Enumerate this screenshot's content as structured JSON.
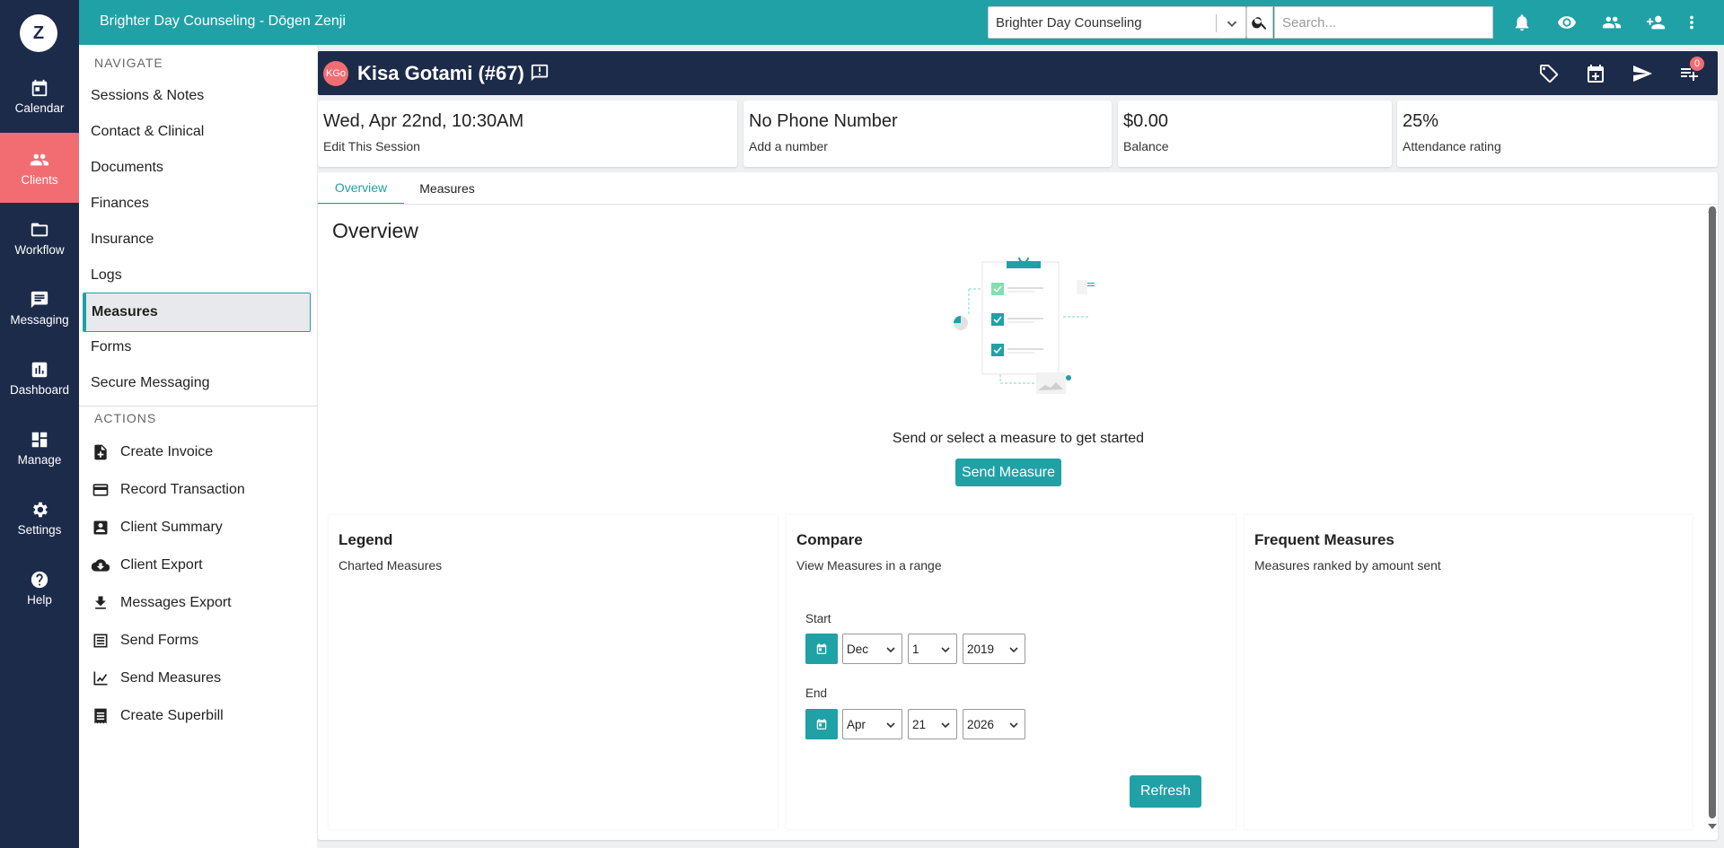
{
  "app": {
    "logo_letter": "Z",
    "title": "Brighter Day Counseling - Dōgen Zenji"
  },
  "rail": {
    "items": [
      {
        "label": "Calendar",
        "icon": "calendar-icon"
      },
      {
        "label": "Clients",
        "icon": "clients-icon",
        "active": true
      },
      {
        "label": "Workflow",
        "icon": "folder-icon"
      },
      {
        "label": "Messaging",
        "icon": "message-icon"
      },
      {
        "label": "Dashboard",
        "icon": "chart-icon"
      },
      {
        "label": "Manage",
        "icon": "grid-icon"
      },
      {
        "label": "Settings",
        "icon": "gear-icon"
      },
      {
        "label": "Help",
        "icon": "help-icon"
      }
    ]
  },
  "topbar": {
    "org_select_value": "Brighter Day Counseling",
    "search_placeholder": "Search...",
    "icons": [
      "bell-icon",
      "eye-icon",
      "people-icon",
      "add-person-icon",
      "more-vertical-icon"
    ]
  },
  "sidenav": {
    "navigate_header": "NAVIGATE",
    "items": [
      {
        "label": "Sessions & Notes"
      },
      {
        "label": "Contact & Clinical"
      },
      {
        "label": "Documents"
      },
      {
        "label": "Finances"
      },
      {
        "label": "Insurance"
      },
      {
        "label": "Logs"
      },
      {
        "label": "Measures",
        "active": true
      },
      {
        "label": "Forms"
      },
      {
        "label": "Secure Messaging"
      }
    ],
    "actions_header": "ACTIONS",
    "actions": [
      {
        "label": "Create Invoice",
        "icon": "invoice-add-icon"
      },
      {
        "label": "Record Transaction",
        "icon": "credit-card-icon"
      },
      {
        "label": "Client Summary",
        "icon": "contact-card-icon"
      },
      {
        "label": "Client Export",
        "icon": "cloud-download-icon"
      },
      {
        "label": "Messages Export",
        "icon": "download-icon"
      },
      {
        "label": "Send Forms",
        "icon": "list-icon"
      },
      {
        "label": "Send Measures",
        "icon": "line-chart-icon"
      },
      {
        "label": "Create Superbill",
        "icon": "receipt-icon"
      }
    ]
  },
  "client": {
    "initials": "KGo",
    "name": "Kisa Gotami (#67)",
    "header_icons": [
      "tag-icon",
      "calendar-add-icon",
      "send-icon",
      "playlist-add-icon"
    ],
    "badge_count": "0"
  },
  "cards": [
    {
      "big": "Wed, Apr 22nd, 10:30AM",
      "small": "Edit This Session"
    },
    {
      "big": "No Phone Number",
      "small": "Add a number"
    },
    {
      "big": "$0.00",
      "small": "Balance"
    },
    {
      "big": "25%",
      "small": "Attendance rating"
    }
  ],
  "tabs": [
    {
      "label": "Overview",
      "active": true
    },
    {
      "label": "Measures"
    }
  ],
  "overview": {
    "title": "Overview",
    "empty_message": "Send or select a measure to get started",
    "send_button": "Send Measure"
  },
  "legend": {
    "title": "Legend",
    "subtitle": "Charted Measures"
  },
  "compare": {
    "title": "Compare",
    "subtitle": "View Measures in a range",
    "start_label": "Start",
    "start": {
      "month": "Dec",
      "day": "1",
      "year": "2019"
    },
    "end_label": "End",
    "end": {
      "month": "Apr",
      "day": "21",
      "year": "2026"
    },
    "refresh_button": "Refresh"
  },
  "frequent": {
    "title": "Frequent Measures",
    "subtitle": "Measures ranked by amount sent"
  },
  "colors": {
    "teal": "#20a1a6",
    "navy": "#1d2b4a",
    "coral": "#f26d72"
  }
}
